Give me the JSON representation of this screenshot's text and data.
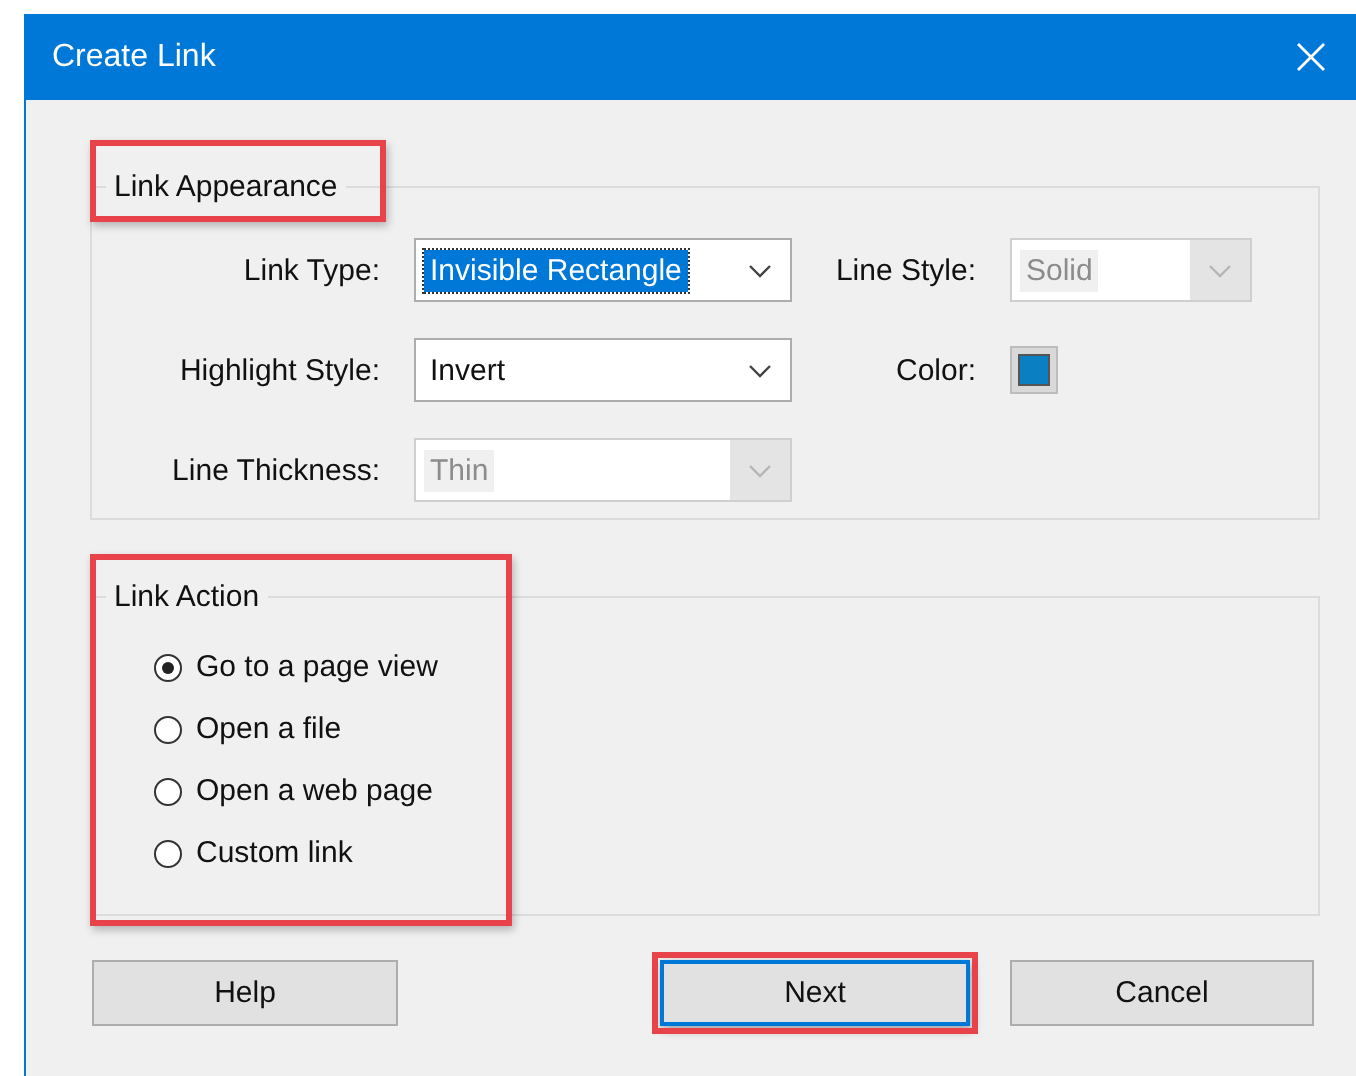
{
  "window": {
    "title": "Create Link"
  },
  "link_appearance": {
    "title": "Link Appearance",
    "highlighted": true,
    "fields": [
      {
        "kind": "dropdown",
        "label": "Link Type:",
        "value": "Invisible Rectangle",
        "focused": true,
        "disabled": false
      },
      {
        "kind": "dropdown",
        "label": "Line Style:",
        "value": "Solid",
        "focused": false,
        "disabled": true
      },
      {
        "kind": "dropdown",
        "label": "Highlight Style:",
        "value": "Invert",
        "focused": false,
        "disabled": false
      },
      {
        "kind": "color",
        "label": "Color:",
        "color": "#0a7fc2"
      },
      {
        "kind": "dropdown",
        "label": "Line Thickness:",
        "value": "Thin",
        "focused": false,
        "disabled": true
      }
    ]
  },
  "link_action": {
    "title": "Link Action",
    "highlighted": true,
    "options": [
      {
        "label": "Go to a page view",
        "selected": true
      },
      {
        "label": "Open a file",
        "selected": false
      },
      {
        "label": "Open a web page",
        "selected": false
      },
      {
        "label": "Custom link",
        "selected": false
      }
    ]
  },
  "buttons": [
    {
      "label": "Help",
      "default": false,
      "highlighted": false
    },
    {
      "label": "Next",
      "default": true,
      "highlighted": true
    },
    {
      "label": "Cancel",
      "default": false,
      "highlighted": false
    }
  ]
}
